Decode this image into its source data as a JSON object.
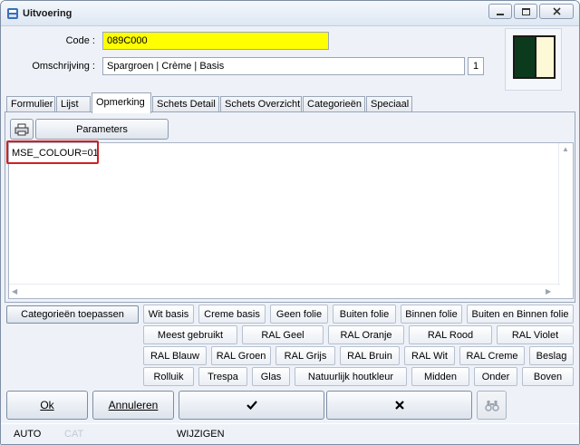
{
  "window": {
    "title": "Uitvoering",
    "controls": [
      "minimize-icon",
      "maximize-icon",
      "close-icon"
    ]
  },
  "fields": {
    "code_label": "Code :",
    "code_value": "089C000",
    "omschrijving_label": "Omschrijving :",
    "omschrijving_value": "Spargroen | Crème | Basis",
    "counter": "1"
  },
  "preview": {
    "left_color": "#0b3b1c",
    "right_color": "#fdf8d6"
  },
  "tabs": [
    {
      "label": "Formulier"
    },
    {
      "label": "Lijst"
    },
    {
      "label": "Opmerking",
      "active": true
    },
    {
      "label": "Schets Detail"
    },
    {
      "label": "Schets Overzicht"
    },
    {
      "label": "Categorieën"
    },
    {
      "label": "Speciaal"
    }
  ],
  "toolbar": {
    "print_icon": "printer-icon",
    "parameters_label": "Parameters"
  },
  "editor": {
    "text": "MSE_COLOUR=01"
  },
  "categories": {
    "apply_label": "Categorieën toepassen",
    "row1": [
      "Wit basis",
      "Creme basis",
      "Geen folie",
      "Buiten folie",
      "Binnen folie",
      "Buiten en Binnen folie"
    ],
    "row2": [
      "Meest gebruikt",
      "RAL Geel",
      "RAL Oranje",
      "RAL Rood",
      "RAL Violet"
    ],
    "row3": [
      "RAL Blauw",
      "RAL Groen",
      "RAL Grijs",
      "RAL Bruin",
      "RAL Wit",
      "RAL Creme",
      "Beslag"
    ],
    "row4": [
      "Rolluik",
      "Trespa",
      "Glas",
      "Natuurlijk houtkleur",
      "Midden",
      "Onder",
      "Boven"
    ]
  },
  "footer": {
    "ok_label": "Ok",
    "cancel_label": "Annuleren",
    "confirm_icon": "checkmark-icon",
    "reject_icon": "x-icon",
    "search_icon": "binoculars-icon"
  },
  "status": {
    "mode": "AUTO",
    "cat": "CAT",
    "action": "WIJZIGEN"
  },
  "colors": {
    "code_bg": "#ffff00",
    "highlight": "#d02020"
  }
}
